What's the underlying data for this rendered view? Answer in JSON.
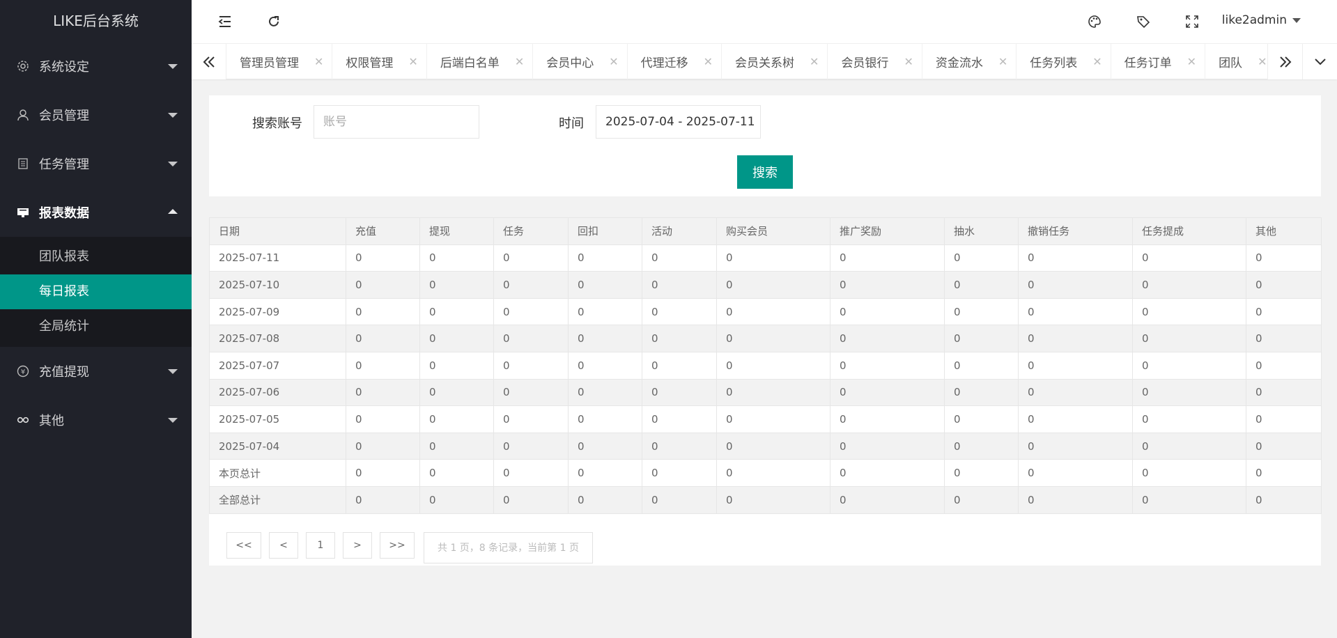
{
  "app": {
    "title": "LIKE后台系统"
  },
  "sidebar": {
    "items": [
      {
        "label": "系统设定",
        "icon": "gear-icon"
      },
      {
        "label": "会员管理",
        "icon": "user-icon"
      },
      {
        "label": "任务管理",
        "icon": "document-icon"
      },
      {
        "label": "报表数据",
        "icon": "monitor-icon"
      },
      {
        "label": "充值提现",
        "icon": "yen-icon"
      },
      {
        "label": "其他",
        "icon": "link-icon"
      }
    ],
    "reports_sub": [
      "团队报表",
      "每日报表",
      "全局统计"
    ],
    "active_sub": "每日报表"
  },
  "header": {
    "user": "like2admin",
    "icons": [
      "collapse-menu-icon",
      "refresh-icon",
      "palette-icon",
      "tag-icon",
      "fullscreen-icon"
    ]
  },
  "tabs": [
    "管理员管理",
    "权限管理",
    "后端白名单",
    "会员中心",
    "代理迁移",
    "会员关系树",
    "会员银行",
    "资金流水",
    "任务列表",
    "任务订单",
    "团队"
  ],
  "search": {
    "account_label": "搜索账号",
    "account_placeholder": "账号",
    "account_value": "",
    "time_label": "时间",
    "time_value": "2025-07-04 - 2025-07-11",
    "button": "搜索"
  },
  "table": {
    "headers": [
      "日期",
      "充值",
      "提现",
      "任务",
      "回扣",
      "活动",
      "购买会员",
      "推广奖励",
      "抽水",
      "撤销任务",
      "任务提成",
      "其他"
    ],
    "rows": [
      [
        "2025-07-11",
        "0",
        "0",
        "0",
        "0",
        "0",
        "0",
        "0",
        "0",
        "0",
        "0",
        "0"
      ],
      [
        "2025-07-10",
        "0",
        "0",
        "0",
        "0",
        "0",
        "0",
        "0",
        "0",
        "0",
        "0",
        "0"
      ],
      [
        "2025-07-09",
        "0",
        "0",
        "0",
        "0",
        "0",
        "0",
        "0",
        "0",
        "0",
        "0",
        "0"
      ],
      [
        "2025-07-08",
        "0",
        "0",
        "0",
        "0",
        "0",
        "0",
        "0",
        "0",
        "0",
        "0",
        "0"
      ],
      [
        "2025-07-07",
        "0",
        "0",
        "0",
        "0",
        "0",
        "0",
        "0",
        "0",
        "0",
        "0",
        "0"
      ],
      [
        "2025-07-06",
        "0",
        "0",
        "0",
        "0",
        "0",
        "0",
        "0",
        "0",
        "0",
        "0",
        "0"
      ],
      [
        "2025-07-05",
        "0",
        "0",
        "0",
        "0",
        "0",
        "0",
        "0",
        "0",
        "0",
        "0",
        "0"
      ],
      [
        "2025-07-04",
        "0",
        "0",
        "0",
        "0",
        "0",
        "0",
        "0",
        "0",
        "0",
        "0",
        "0"
      ],
      [
        "本页总计",
        "0",
        "0",
        "0",
        "0",
        "0",
        "0",
        "0",
        "0",
        "0",
        "0",
        "0"
      ],
      [
        "全部总计",
        "0",
        "0",
        "0",
        "0",
        "0",
        "0",
        "0",
        "0",
        "0",
        "0",
        "0"
      ]
    ]
  },
  "pagination": {
    "first": "<<",
    "prev": "<",
    "page": "1",
    "next": ">",
    "last": ">>",
    "info": "共 1 页，8 条记录，当前第 1 页"
  },
  "colors": {
    "accent": "#009688",
    "sidebar_bg": "#20222a"
  }
}
